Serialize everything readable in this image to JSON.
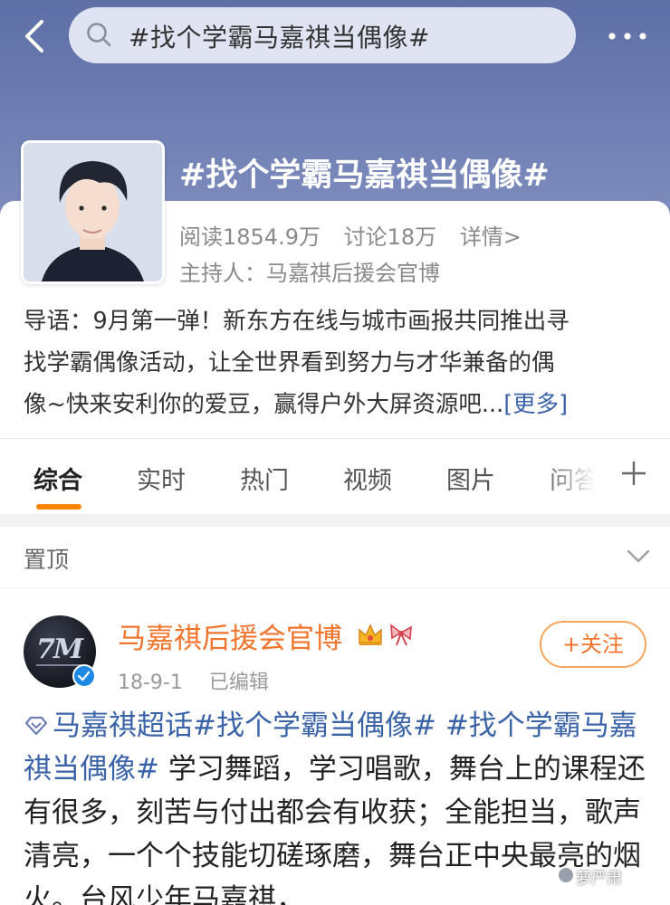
{
  "search": {
    "query": "#找个学霸马嘉祺当偶像#"
  },
  "topic": {
    "title": "#找个学霸马嘉祺当偶像#",
    "reads": "阅读1854.9万",
    "discussions": "讨论18万",
    "details": "详情>",
    "host": "主持人：马嘉祺后援会官博",
    "intro_lines": [
      "导语：9月第一弹！新东方在线与城市画报共同推出寻",
      "找学霸偶像活动，让全世界看到努力与才华兼备的偶",
      "像~快来安利你的爱豆，赢得户外大屏资源吧..."
    ],
    "more": "[更多]"
  },
  "tabs": [
    {
      "label": "综合",
      "active": true
    },
    {
      "label": "实时",
      "active": false
    },
    {
      "label": "热门",
      "active": false
    },
    {
      "label": "视频",
      "active": false
    },
    {
      "label": "图片",
      "active": false
    },
    {
      "label": "问答",
      "active": false
    }
  ],
  "pinned": {
    "label": "置顶"
  },
  "post": {
    "author": "马嘉祺后援会官博",
    "date": "18-9-1",
    "edited": "已编辑",
    "follow": "+关注",
    "avatar_text": "7M",
    "tag1": "马嘉祺超话",
    "tag2": "#找个学霸当偶像#",
    "tag3": "#找个学霸马嘉祺当偶像#",
    "body": "学习舞蹈，学习唱歌，舞台上的课程还有很多，刻苦与付出都会有收获；全能担当，歌声清亮，一个个技能切磋琢磨，舞台正中央最亮的烟火。台风少年马嘉祺，"
  },
  "watermark": "萝严肃",
  "colors": {
    "accent_orange": "#ff8200",
    "author_orange": "#f0742c",
    "link_blue": "#3b63a8",
    "header_blue": "#6f7fb4",
    "verify_blue": "#1e88e5"
  },
  "icons": {
    "back": "back-arrow-icon",
    "search": "search-icon",
    "more": "more-dots-icon",
    "plus": "plus-icon",
    "chevron": "chevron-down-icon",
    "crown": "crown-icon",
    "bow": "bow-icon",
    "verify": "verified-badge-icon",
    "super_topic": "super-topic-icon"
  }
}
